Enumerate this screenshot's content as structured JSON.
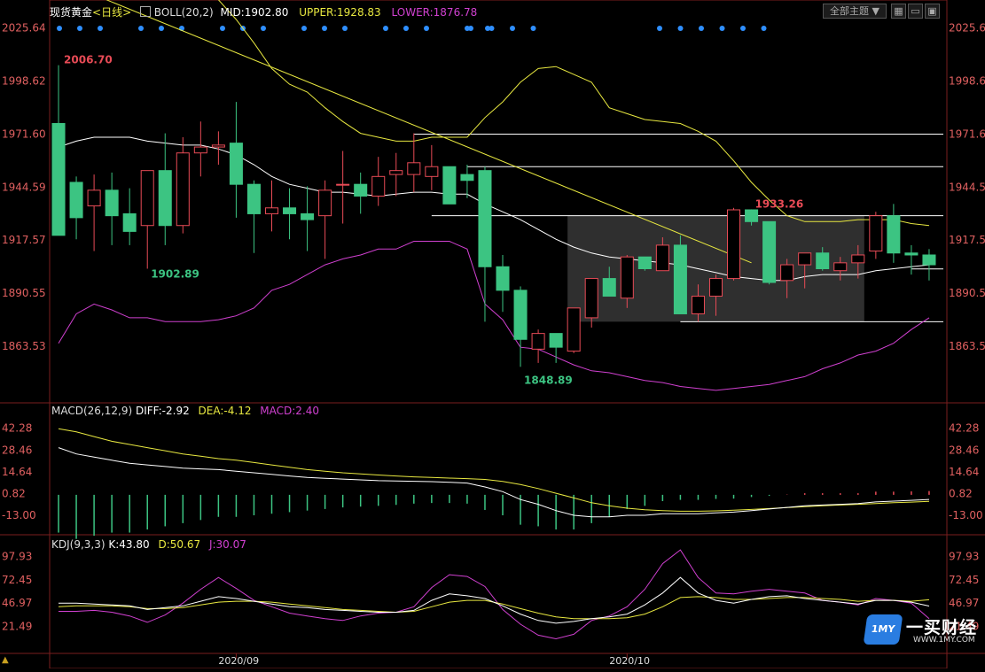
{
  "header": {
    "instrument": "现货黄金",
    "period": "<日线>",
    "indicator": "BOLL(20,2)",
    "mid": "MID:1902.80",
    "upper": "UPPER:1928.83",
    "lower": "LOWER:1876.78",
    "theme_button": "全部主题",
    "colors": {
      "mid": "#ffffff",
      "upper": "#e8e840",
      "lower": "#d040d0"
    }
  },
  "main_axis": {
    "ticks": [
      "2025.64",
      "1998.62",
      "1971.60",
      "1944.59",
      "1917.57",
      "1890.55",
      "1863.53"
    ],
    "tick_values": [
      2025.64,
      1998.62,
      1971.6,
      1944.59,
      1917.57,
      1890.55,
      1863.53
    ],
    "ylim": [
      1836,
      2030
    ]
  },
  "annotations": {
    "high": "2006.70",
    "low1": "1902.89",
    "low2": "1848.89",
    "peak": "1933.26"
  },
  "macd_panel": {
    "title": "MACD(26,12,9)",
    "diff": "DIFF:-2.92",
    "dea": "DEA:-4.12",
    "macd": "MACD:2.40",
    "ticks": [
      "42.28",
      "28.46",
      "14.64",
      "0.82",
      "-13.00"
    ],
    "tick_values": [
      42.28,
      28.46,
      14.64,
      0.82,
      -13.0
    ],
    "ylim": [
      -22,
      50
    ]
  },
  "kdj_panel": {
    "title": "KDJ(9,3,3)",
    "k": "K:43.80",
    "d": "D:50.67",
    "j": "J:30.07",
    "ticks": [
      "97.93",
      "72.45",
      "46.97",
      "21.49"
    ],
    "tick_values": [
      97.93,
      72.45,
      46.97,
      21.49
    ],
    "ylim": [
      -5,
      108
    ]
  },
  "x_axis": {
    "labels": [
      {
        "text": "2020/09",
        "index": 10
      },
      {
        "text": "2020/10",
        "index": 32
      }
    ]
  },
  "brand": {
    "name": "一买财经",
    "url": "WWW.1MY.COM",
    "mark": "1MY"
  },
  "chart_data": {
    "type": "candlestick",
    "series": [
      {
        "name": "candles",
        "values": [
          [
            1977,
            2006.7,
            1924,
            1920
          ],
          [
            1947,
            1950,
            1918,
            1929
          ],
          [
            1935,
            1951,
            1912,
            1943
          ],
          [
            1943,
            1952,
            1915,
            1930
          ],
          [
            1931,
            1944,
            1915,
            1922
          ],
          [
            1925,
            1953,
            1903,
            1953
          ],
          [
            1953,
            1972,
            1915,
            1925
          ],
          [
            1925,
            1970,
            1921,
            1962
          ],
          [
            1962,
            1978,
            1950,
            1965
          ],
          [
            1965,
            1973,
            1956,
            1966
          ],
          [
            1967,
            1988,
            1929,
            1946
          ],
          [
            1946,
            1948,
            1911,
            1931
          ],
          [
            1931,
            1948,
            1922,
            1934
          ],
          [
            1934,
            1944,
            1918,
            1931
          ],
          [
            1931,
            1945,
            1912,
            1928
          ],
          [
            1930,
            1948,
            1908,
            1943
          ],
          [
            1946,
            1963,
            1926,
            1946
          ],
          [
            1946,
            1952,
            1931,
            1940
          ],
          [
            1940,
            1960,
            1935,
            1950
          ],
          [
            1951,
            1962,
            1940,
            1953
          ],
          [
            1951,
            1972,
            1942,
            1957
          ],
          [
            1950,
            1966,
            1943,
            1955
          ],
          [
            1955,
            1953,
            1937,
            1936
          ],
          [
            1951,
            1956,
            1939,
            1948
          ],
          [
            1953,
            1955,
            1876,
            1904
          ],
          [
            1904,
            1910,
            1881,
            1892
          ],
          [
            1892,
            1894,
            1853,
            1867
          ],
          [
            1862,
            1872,
            1855,
            1870
          ],
          [
            1870,
            1867,
            1855,
            1863
          ],
          [
            1861,
            1880,
            1860,
            1883
          ],
          [
            1878,
            1898,
            1873,
            1898
          ],
          [
            1898,
            1904,
            1891,
            1889
          ],
          [
            1888,
            1910,
            1883,
            1909
          ],
          [
            1909,
            1904,
            1902,
            1903
          ],
          [
            1902,
            1919,
            1902,
            1915
          ],
          [
            1915,
            1920,
            1880,
            1880
          ],
          [
            1880,
            1895,
            1876,
            1889
          ],
          [
            1889,
            1900,
            1879,
            1898
          ],
          [
            1898,
            1934,
            1897,
            1933
          ],
          [
            1933,
            1933.26,
            1925,
            1927
          ],
          [
            1927,
            1920,
            1895,
            1896
          ],
          [
            1897,
            1908,
            1888,
            1905
          ],
          [
            1905,
            1911,
            1893,
            1911
          ],
          [
            1911,
            1914,
            1902,
            1903
          ],
          [
            1902,
            1909,
            1897,
            1906
          ],
          [
            1906,
            1915,
            1898,
            1910
          ],
          [
            1912,
            1932,
            1908,
            1930
          ],
          [
            1930,
            1936,
            1906,
            1911
          ],
          [
            1911,
            1915,
            1900,
            1910
          ],
          [
            1910,
            1913,
            1897,
            1905
          ]
        ]
      },
      {
        "name": "MID",
        "values": [
          1965,
          1968,
          1970,
          1970,
          1970,
          1968,
          1967,
          1966,
          1966,
          1964,
          1961,
          1956,
          1950,
          1946,
          1944,
          1942,
          1942,
          1941,
          1940,
          1941,
          1942,
          1942,
          1941,
          1941,
          1936,
          1932,
          1928,
          1923,
          1918,
          1914,
          1911,
          1909,
          1908,
          1907,
          1906,
          1905,
          1903,
          1901,
          1899,
          1898,
          1897,
          1897,
          1899,
          1900,
          1900,
          1900,
          1902,
          1903,
          1904,
          1905
        ]
      },
      {
        "name": "UPPER",
        "values": [
          2055,
          2055,
          2054,
          2053,
          2052,
          2050,
          2048,
          2046,
          2044,
          2040,
          2030,
          2018,
          2005,
          1997,
          1993,
          1985,
          1978,
          1972,
          1970,
          1968,
          1968,
          1970,
          1970,
          1970,
          1980,
          1988,
          1998,
          2005,
          2006,
          2002,
          1998,
          1985,
          1982,
          1979,
          1978,
          1977,
          1973,
          1968,
          1958,
          1947,
          1938,
          1930,
          1927,
          1927,
          1927,
          1928,
          1928,
          1928,
          1926,
          1925
        ]
      },
      {
        "name": "LOWER",
        "values": [
          1865,
          1880,
          1885,
          1882,
          1878,
          1878,
          1876,
          1876,
          1876,
          1877,
          1879,
          1883,
          1892,
          1895,
          1900,
          1905,
          1908,
          1910,
          1913,
          1913,
          1917,
          1917,
          1917,
          1913,
          1885,
          1877,
          1863,
          1862,
          1858,
          1854,
          1851,
          1850,
          1848,
          1846,
          1845,
          1843,
          1842,
          1841,
          1842,
          1843,
          1844,
          1846,
          1848,
          1852,
          1855,
          1859,
          1861,
          1865,
          1872,
          1878
        ]
      },
      {
        "name": "DIFF",
        "values": [
          30,
          26,
          24,
          22,
          20,
          19,
          18,
          17,
          16.5,
          16,
          15,
          14,
          13,
          12,
          11,
          10.5,
          10,
          9.5,
          9,
          8.8,
          8.6,
          8.4,
          8,
          7.5,
          5,
          2,
          -3,
          -6,
          -10,
          -13,
          -14,
          -14,
          -13,
          -13,
          -12,
          -12,
          -12,
          -11.5,
          -11,
          -10,
          -9,
          -8,
          -7,
          -6.5,
          -6,
          -5.5,
          -4.5,
          -4,
          -3.5,
          -2.92
        ]
      },
      {
        "name": "DEA",
        "values": [
          42,
          40,
          37,
          34,
          32,
          30,
          28,
          26,
          24.5,
          23,
          22,
          20.5,
          19,
          17.5,
          16,
          15,
          14,
          13.3,
          12.6,
          12,
          11.4,
          11,
          10.6,
          10.3,
          9.8,
          8.5,
          6.5,
          4,
          1,
          -2,
          -5,
          -7,
          -8.5,
          -9.5,
          -10,
          -10.4,
          -10.4,
          -10.2,
          -9.8,
          -9.3,
          -8.7,
          -8.1,
          -7.5,
          -7,
          -6.5,
          -6,
          -5.5,
          -5,
          -4.6,
          -4.12
        ]
      },
      {
        "name": "MACD",
        "values": [
          -24,
          -28,
          -26,
          -24,
          -24,
          -22,
          -20,
          -18,
          -16,
          -14,
          -14,
          -13,
          -12,
          -11,
          -10,
          -9,
          -8,
          -7.5,
          -7,
          -6.4,
          -5.6,
          -5.2,
          -5.2,
          -5.6,
          -9.6,
          -13,
          -19,
          -20,
          -22,
          -22,
          -18,
          -14,
          -9,
          -7,
          -4,
          -3.2,
          -3.2,
          -2.6,
          -2.4,
          -1.4,
          -0.6,
          0.2,
          1,
          1,
          1,
          1,
          2,
          2,
          2.2,
          2.4
        ]
      },
      {
        "name": "K",
        "values": [
          47,
          47,
          46,
          45,
          44,
          40,
          42,
          44,
          49,
          54,
          52,
          49,
          46,
          43,
          42,
          40,
          39,
          38,
          37,
          37,
          39,
          50,
          57,
          55,
          52,
          44,
          35,
          28,
          25,
          27,
          30,
          32,
          35,
          45,
          58,
          75,
          58,
          50,
          47,
          51,
          54,
          55,
          52,
          50,
          48,
          46,
          50,
          50,
          48,
          43.8
        ]
      },
      {
        "name": "D",
        "values": [
          43,
          44,
          44,
          44,
          43,
          41,
          41,
          42,
          45,
          48,
          49,
          49,
          48,
          46,
          44,
          42,
          40,
          39,
          38,
          37,
          38,
          43,
          48,
          50,
          50,
          46,
          41,
          36,
          32,
          30,
          30,
          30,
          31,
          35,
          43,
          53,
          54,
          53,
          51,
          51,
          52,
          53,
          53,
          52,
          51,
          49,
          50,
          50,
          49,
          50.67
        ]
      },
      {
        "name": "J",
        "values": [
          38,
          38,
          39,
          37,
          33,
          26,
          34,
          47,
          62,
          75,
          63,
          50,
          43,
          36,
          33,
          30,
          28,
          33,
          36,
          37,
          43,
          64,
          78,
          76,
          65,
          40,
          24,
          12,
          8,
          13,
          28,
          33,
          43,
          62,
          90,
          105,
          75,
          58,
          57,
          60,
          62,
          60,
          58,
          50,
          48,
          45,
          52,
          50,
          47,
          30.07
        ]
      }
    ],
    "overlays": {
      "support_resistance": [
        1971.6,
        1955,
        1930,
        1902.89,
        1876
      ],
      "box": {
        "from_index": 29,
        "to_index": 45,
        "low": 1876,
        "high": 1930
      },
      "trendline": {
        "from": [
          0,
          2050
        ],
        "to": [
          39,
          1906
        ]
      }
    },
    "up_color": "#e84b56",
    "down_color": "#3cc482"
  }
}
